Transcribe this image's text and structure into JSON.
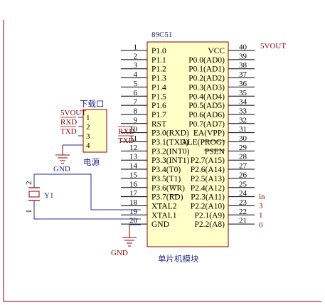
{
  "colors": {
    "background": "#ffffff",
    "border": "#8b0000",
    "chip_fill": "#ffffc8",
    "chip_stroke": "#8b0000",
    "wire": "#2a2a8a",
    "pin": "#000000",
    "power_label": "#8b0000",
    "ground": "#8b0000",
    "text_blue": "#2a2a8a"
  },
  "mcu": {
    "part_name": "89C51",
    "caption": "单片机模块",
    "left_pins": [
      {
        "num": "1",
        "label": "P1.0"
      },
      {
        "num": "2",
        "label": "P1.1"
      },
      {
        "num": "3",
        "label": "P1.2"
      },
      {
        "num": "4",
        "label": "P1.3"
      },
      {
        "num": "5",
        "label": "P1.4"
      },
      {
        "num": "6",
        "label": "P1.5"
      },
      {
        "num": "7",
        "label": "P1.6"
      },
      {
        "num": "8",
        "label": "P1.7"
      },
      {
        "num": "9",
        "label": "RST"
      },
      {
        "num": "10",
        "label": "P3.0(RXD)"
      },
      {
        "num": "11",
        "label": "P3.1(TXD)"
      },
      {
        "num": "12",
        "label": "P3.2(INT0)"
      },
      {
        "num": "13",
        "label": "P3.3(INT1)"
      },
      {
        "num": "14",
        "label": "P3.4(T0)"
      },
      {
        "num": "15",
        "label": "P3.5(T1)"
      },
      {
        "num": "16",
        "label": "P3.6(WR)"
      },
      {
        "num": "17",
        "label": "P3.7(RD)"
      },
      {
        "num": "18",
        "label": "XTAL2"
      },
      {
        "num": "19",
        "label": "XTAL1"
      },
      {
        "num": "20",
        "label": "GND"
      }
    ],
    "right_pins": [
      {
        "num": "40",
        "label": "VCC"
      },
      {
        "num": "39",
        "label": "P0.0(AD0)"
      },
      {
        "num": "38",
        "label": "P0.1(AD1)"
      },
      {
        "num": "37",
        "label": "P0.2(AD2)"
      },
      {
        "num": "36",
        "label": "P0.3(AD3)"
      },
      {
        "num": "35",
        "label": "P0.4(AD4)"
      },
      {
        "num": "34",
        "label": "P0.5(AD5)"
      },
      {
        "num": "33",
        "label": "P0.6(AD6)"
      },
      {
        "num": "32",
        "label": "P0.7(AD7)"
      },
      {
        "num": "31",
        "label": "EA(VPP)"
      },
      {
        "num": "30",
        "label": "ALE(PROG)"
      },
      {
        "num": "29",
        "label": "PSEN"
      },
      {
        "num": "28",
        "label": "P2.7(A15)"
      },
      {
        "num": "27",
        "label": "P2.6(A14)"
      },
      {
        "num": "26",
        "label": "P2.5(A13)"
      },
      {
        "num": "25",
        "label": "P2.4(A12)"
      },
      {
        "num": "24",
        "label": "P2.3(A11)"
      },
      {
        "num": "23",
        "label": "P2.2(A10)"
      },
      {
        "num": "22",
        "label": "P2.1(A9)"
      },
      {
        "num": "21",
        "label": "P2.2(A8)"
      }
    ],
    "vcc_net": "5VOUT",
    "rxd_net": "RXD",
    "txd_net": "TXD",
    "gnd_net": "GND"
  },
  "connector": {
    "title": "下载口",
    "caption": "电源",
    "pins": [
      {
        "num": "1",
        "net": "5VOUT"
      },
      {
        "num": "2",
        "net": "RXD"
      },
      {
        "num": "3",
        "net": "TXD"
      },
      {
        "num": "4",
        "net": ""
      }
    ],
    "gnd_net": "GND"
  },
  "crystal": {
    "ref": "Y1",
    "pin_top": "2",
    "pin_bottom": "1"
  },
  "right_edge_fragments": [
    "in",
    "3",
    "1",
    "0"
  ]
}
